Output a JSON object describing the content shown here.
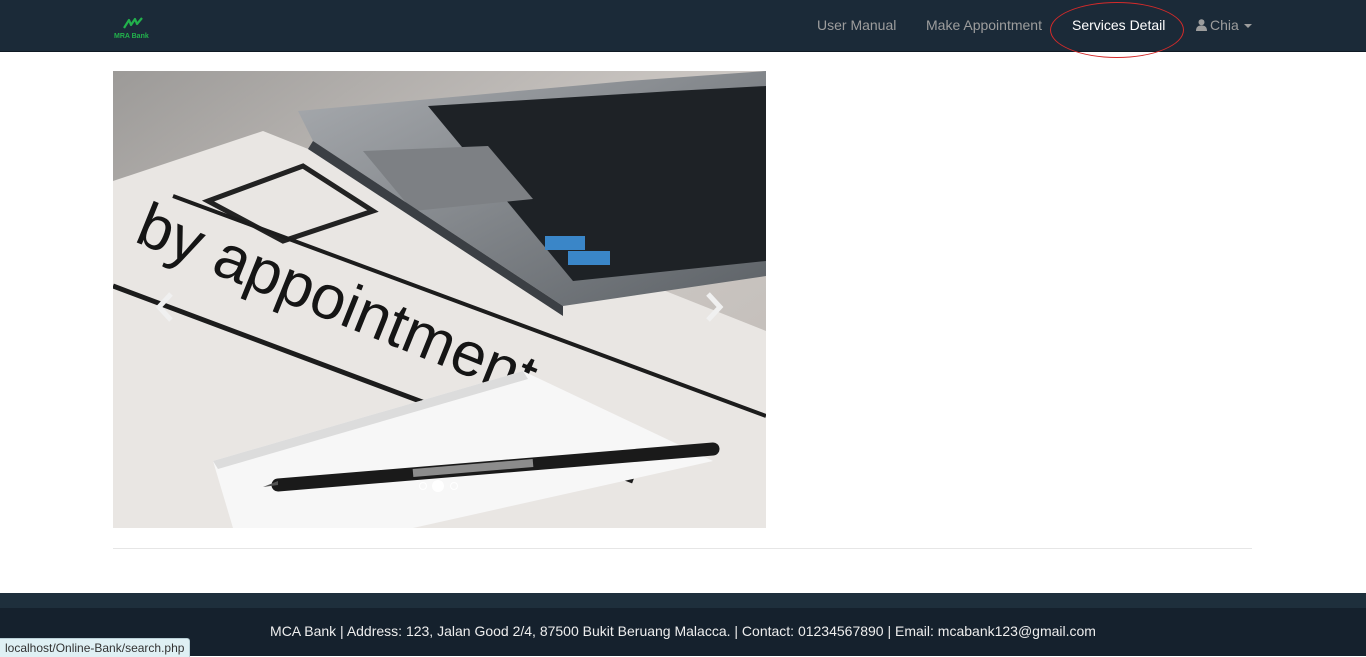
{
  "brand": {
    "name": "MRA Bank",
    "color": "#22b14c"
  },
  "nav": {
    "user_manual": "User Manual",
    "make_appointment": "Make Appointment",
    "services_detail": "Services Detail",
    "user_name": "Chia",
    "user_icon": "user-icon",
    "dropdown_icon": "caret-down-icon"
  },
  "carousel": {
    "slide_text": "by appointment",
    "prev_icon": "chevron-left-icon",
    "next_icon": "chevron-right-icon",
    "slide_count": 3,
    "active_slide": 2
  },
  "footer": {
    "text": "MCA Bank | Address: 123, Jalan Good 2/4, 87500 Bukit Beruang Malacca. | Contact: 01234567890 | Email: mcabank123@gmail.com"
  },
  "status_bar": {
    "url": "localhost/Online-Bank/search.php"
  },
  "colors": {
    "navbar": "#1b2a38",
    "nav_link": "#9d9d9d",
    "nav_active": "#ffffff",
    "annotation": "#d42a2a",
    "footer": "#15212d"
  }
}
